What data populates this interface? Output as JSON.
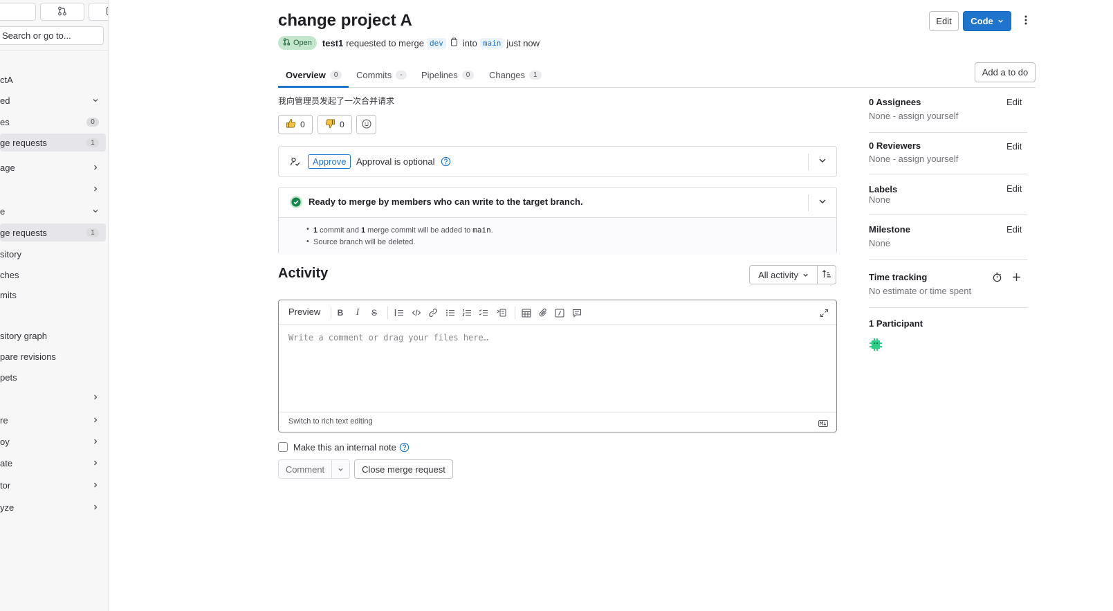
{
  "sidebar": {
    "search_placeholder": "Search or go to...",
    "items": [
      {
        "label": "ctA",
        "badge": null,
        "chevron": null,
        "active": false
      },
      {
        "label": "ed",
        "badge": null,
        "chevron": "down",
        "active": false
      },
      {
        "label": "es",
        "badge": "0",
        "chevron": null,
        "active": false
      },
      {
        "label": "ge requests",
        "badge": "1",
        "chevron": null,
        "active": true
      },
      {
        "label": "age",
        "badge": null,
        "chevron": "right",
        "active": false
      },
      {
        "label": "",
        "badge": null,
        "chevron": "right",
        "active": false
      },
      {
        "label": "e",
        "badge": null,
        "chevron": "down",
        "active": false
      },
      {
        "label": "ge requests",
        "badge": "1",
        "chevron": null,
        "active": true
      },
      {
        "label": "sitory",
        "badge": null,
        "chevron": null,
        "active": false
      },
      {
        "label": "ches",
        "badge": null,
        "chevron": null,
        "active": false
      },
      {
        "label": "mits",
        "badge": null,
        "chevron": null,
        "active": false
      },
      {
        "label": "sitory graph",
        "badge": null,
        "chevron": null,
        "active": false
      },
      {
        "label": "pare revisions",
        "badge": null,
        "chevron": null,
        "active": false
      },
      {
        "label": "pets",
        "badge": null,
        "chevron": null,
        "active": false
      },
      {
        "label": "",
        "badge": null,
        "chevron": "right",
        "active": false
      },
      {
        "label": "re",
        "badge": null,
        "chevron": "right",
        "active": false
      },
      {
        "label": "oy",
        "badge": null,
        "chevron": "right",
        "active": false
      },
      {
        "label": "ate",
        "badge": null,
        "chevron": "right",
        "active": false
      },
      {
        "label": "tor",
        "badge": null,
        "chevron": "right",
        "active": false
      },
      {
        "label": "yze",
        "badge": null,
        "chevron": "right",
        "active": false
      }
    ]
  },
  "header": {
    "title": "change project A",
    "status": "Open",
    "author": "test1",
    "requested_text": "requested to merge",
    "source_branch": "dev",
    "into_text": "into",
    "target_branch": "main",
    "time": "just now",
    "edit_label": "Edit",
    "code_label": "Code",
    "add_todo_label": "Add a to do"
  },
  "tabs": [
    {
      "label": "Overview",
      "count": "0"
    },
    {
      "label": "Commits",
      "count": "-"
    },
    {
      "label": "Pipelines",
      "count": "0"
    },
    {
      "label": "Changes",
      "count": "1"
    }
  ],
  "description": "我向管理员发起了一次合并请求",
  "awards": {
    "thumbs_up": "0",
    "thumbs_down": "0"
  },
  "approval": {
    "approve_label": "Approve",
    "optional_text": "Approval is optional"
  },
  "merge": {
    "status_text": "Ready to merge by members who can write to the target branch.",
    "line1_num1": "1",
    "line1_text1": "commit and",
    "line1_num2": "1",
    "line1_text2": "merge commit will be added to",
    "line1_branch": "main",
    "line1_end": ".",
    "line2": "Source branch will be deleted."
  },
  "activity": {
    "title": "Activity",
    "filter_label": "All activity",
    "preview_label": "Preview",
    "placeholder": "Write a comment or drag your files here…",
    "switch_label": "Switch to rich text editing",
    "internal_note_label": "Make this an internal note",
    "comment_label": "Comment",
    "close_label": "Close merge request"
  },
  "right_sidebar": {
    "assignees_title": "0 Assignees",
    "assignees_value": "None - assign yourself",
    "reviewers_title": "0 Reviewers",
    "reviewers_value": "None - assign yourself",
    "labels_title": "Labels",
    "labels_value": "None",
    "milestone_title": "Milestone",
    "milestone_value": "None",
    "time_title": "Time tracking",
    "time_value": "No estimate or time spent",
    "participants_title": "1 Participant",
    "edit_label": "Edit"
  },
  "colors": {
    "accent": "#1f75cb",
    "open_bg": "#c3e6cd",
    "open_fg": "#24663b",
    "success": "#108548"
  }
}
